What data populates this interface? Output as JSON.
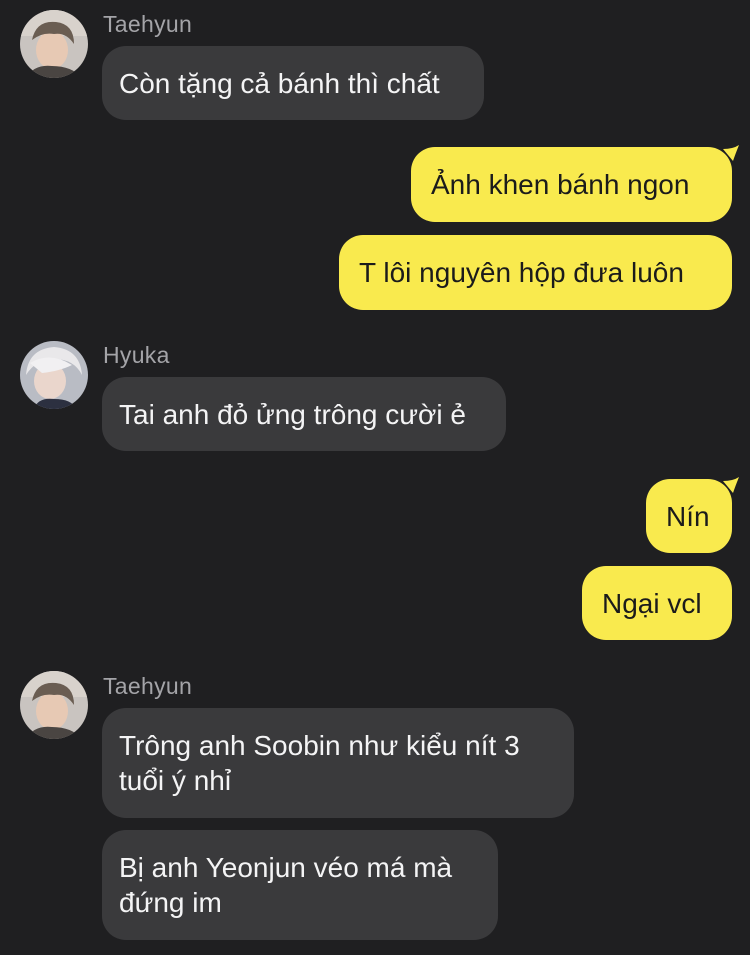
{
  "messages": [
    {
      "sender": "Taehyun",
      "text": "Còn tặng cả bánh thì chất"
    },
    {
      "text": "Ảnh khen bánh ngon"
    },
    {
      "text": "T lôi nguyên hộp đưa luôn"
    },
    {
      "sender": "Hyuka",
      "text": "Tai anh đỏ ửng trông cười ẻ"
    },
    {
      "text": "Nín"
    },
    {
      "text": "Ngại vcl"
    },
    {
      "sender": "Taehyun",
      "text": "Trông anh Soobin như kiểu nít 3 tuổi ý nhỉ"
    },
    {
      "text": "Bị anh Yeonjun véo má mà đứng im"
    }
  ],
  "colors": {
    "background": "#1f1f21",
    "incoming_bubble": "#3a3a3c",
    "outgoing_bubble": "#f9ea4e",
    "sender_name": "#a4a4a8"
  }
}
